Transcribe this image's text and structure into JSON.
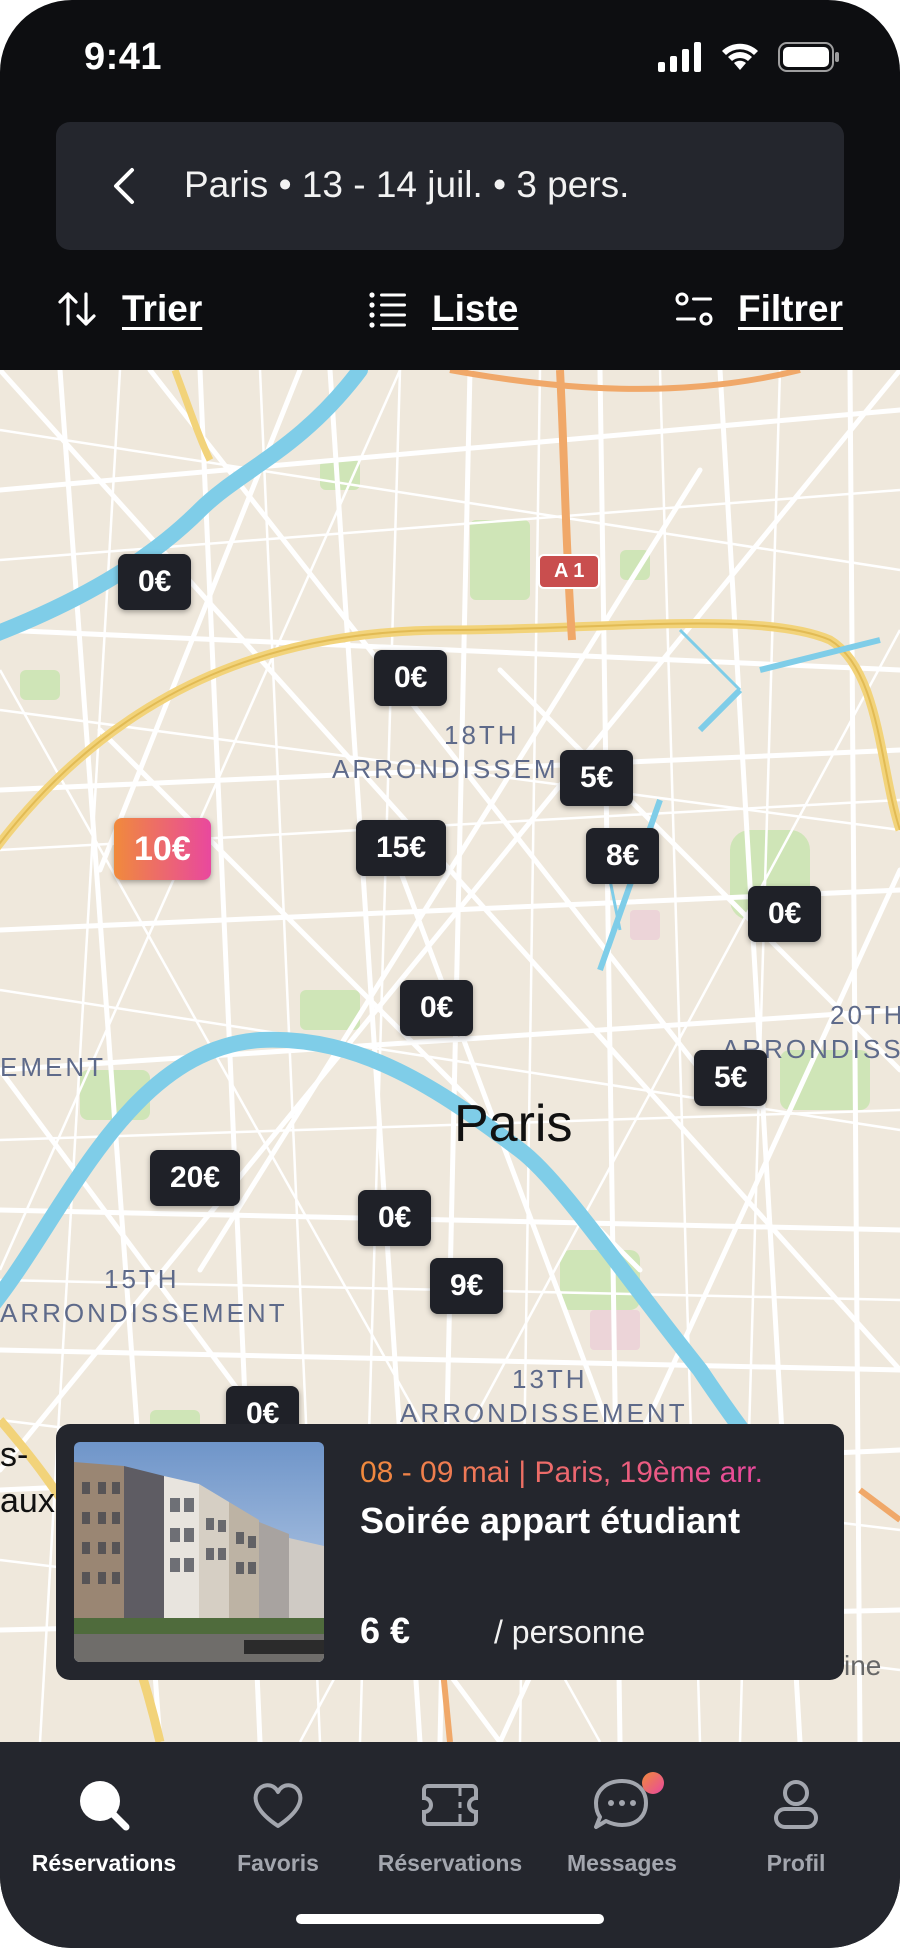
{
  "status_bar": {
    "time": "9:41"
  },
  "search": {
    "query": "Paris • 13 - 14 juil. • 3 pers."
  },
  "toolbar": {
    "sort_label": "Trier",
    "list_label": "Liste",
    "filter_label": "Filtrer"
  },
  "map": {
    "city_label": "Paris",
    "district_labels": {
      "d18_line1": "18TH",
      "d18_line2": "ARRONDISSEM",
      "d20_line1": "20TH",
      "d20_line2": "ARRONDISS",
      "d15_line1": "15TH",
      "d15_line2": "ARRONDISSEMENT",
      "d13_line1": "13TH",
      "d13_line2": "ARRONDISSEMENT",
      "left_edge": "EMENT",
      "left_fragment_1": "s-",
      "left_fragment_2": "aux",
      "right_fragment": "ine"
    },
    "road_badge": "A 1",
    "pins": [
      "0€",
      "0€",
      "5€",
      "10€",
      "15€",
      "8€",
      "0€",
      "0€",
      "5€",
      "20€",
      "0€",
      "9€",
      "0€"
    ],
    "active_pin_color_start": "#f08a3c",
    "active_pin_color_end": "#e9489e"
  },
  "listing_card": {
    "dates": "08 - 09 mai | Paris, 19ème arr.",
    "title": "Soirée appart étudiant",
    "price": "6 €",
    "per": "/ personne"
  },
  "bottom_nav": [
    {
      "label": "Réservations",
      "icon": "search-icon",
      "active": true
    },
    {
      "label": "Favoris",
      "icon": "heart-icon",
      "active": false
    },
    {
      "label": "Réservations",
      "icon": "ticket-icon",
      "active": false
    },
    {
      "label": "Messages",
      "icon": "chat-icon",
      "active": false,
      "badge": true
    },
    {
      "label": "Profil",
      "icon": "profile-icon",
      "active": false
    }
  ]
}
